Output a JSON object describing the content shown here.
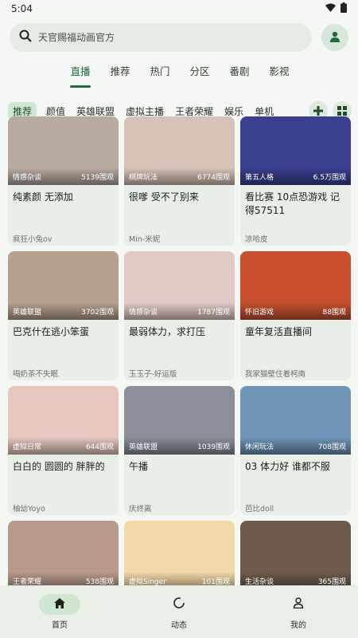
{
  "status": {
    "time": "5:04"
  },
  "search": {
    "placeholder": "天官赐福动画官方"
  },
  "main_tabs": [
    {
      "label": "直播",
      "active": true
    },
    {
      "label": "推荐"
    },
    {
      "label": "热门"
    },
    {
      "label": "分区"
    },
    {
      "label": "番剧"
    },
    {
      "label": "影视"
    }
  ],
  "categories": [
    "推荐",
    "颜值",
    "英雄联盟",
    "虚拟主播",
    "王者荣耀",
    "娱乐",
    "单机"
  ],
  "cards": [
    {
      "tag": "情感杂谈",
      "views": "5139围观",
      "title": "纯素颜 无添加",
      "author": "疯狂小兔ov",
      "bg": "#b8aaa0"
    },
    {
      "tag": "棋牌玩法",
      "views": "6774围观",
      "title": "很嗲 受不了别来",
      "author": "Min-米妮",
      "bg": "#d7c2b8"
    },
    {
      "tag": "第五人格",
      "views": "6.5万围观",
      "title": "看比赛 10点恐游戏 记得57511",
      "author": "凉哈皮",
      "bg": "#3a3f8f"
    },
    {
      "tag": "英雄联盟",
      "views": "3702围观",
      "title": "巴克什在逃小笨蛋",
      "author": "喝奶茶不失眠",
      "bg": "#b7a08e"
    },
    {
      "tag": "情感杂谈",
      "views": "1787围观",
      "title": "最弱体力，求打压",
      "author": "玉玉子-好运版",
      "bg": "#e2c9c6"
    },
    {
      "tag": "怀旧游戏",
      "views": "88围观",
      "title": "童年复活直播间",
      "author": "我家猫壁住着柯南",
      "bg": "#c8502e"
    },
    {
      "tag": "虚拟日常",
      "views": "644围观",
      "title": "白白的 圆圆的 胖胖的",
      "author": "柚幼Yoyo",
      "bg": "#e7c7c0"
    },
    {
      "tag": "英雄联盟",
      "views": "1039围观",
      "title": "午播",
      "author": "庆终离",
      "bg": "#8a8f9a"
    },
    {
      "tag": "休闲玩法",
      "views": "708围观",
      "title": "03 体力好 谁都不服",
      "author": "芭比doll",
      "bg": "#6f94b8"
    },
    {
      "tag": "王者荣耀",
      "views": "538围观",
      "title": "",
      "author": "",
      "bg": "#b89a8c"
    },
    {
      "tag": "虚拟Singer",
      "views": "101围观",
      "title": "",
      "author": "",
      "bg": "#f1d9a8"
    },
    {
      "tag": "生活杂谈",
      "views": "365围观",
      "title": "",
      "author": "",
      "bg": "#6d5a4d"
    }
  ],
  "bottom_nav": [
    {
      "label": "首页",
      "icon": "home-icon",
      "active": true
    },
    {
      "label": "动态",
      "icon": "refresh-icon"
    },
    {
      "label": "我的",
      "icon": "person-icon"
    }
  ],
  "accent_color": "#1f6b3d"
}
